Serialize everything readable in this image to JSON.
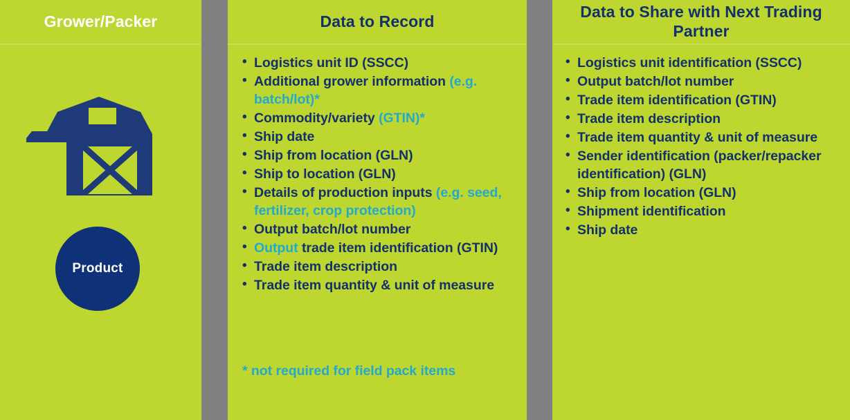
{
  "colors": {
    "panel_green": "#bed730",
    "divider_gray": "#808080",
    "navy": "#14306b",
    "deep_navy": "#0e3177",
    "accent_cyan": "#23a9cc",
    "white": "#ffffff"
  },
  "columns": {
    "left": {
      "header": "Grower/Packer",
      "barn_icon_name": "barn-icon",
      "product_label": "Product"
    },
    "middle": {
      "header": "Data to Record",
      "items": [
        [
          {
            "t": "Logistics unit ID (SSCC)",
            "c": "navy"
          }
        ],
        [
          {
            "t": "Additional grower information ",
            "c": "navy"
          },
          {
            "t": "(e.g. batch/lot)*",
            "c": "accent"
          }
        ],
        [
          {
            "t": "Commodity/variety ",
            "c": "navy"
          },
          {
            "t": "(GTIN)*",
            "c": "accent"
          }
        ],
        [
          {
            "t": "Ship date",
            "c": "navy"
          }
        ],
        [
          {
            "t": "Ship from location (GLN)",
            "c": "navy"
          }
        ],
        [
          {
            "t": "Ship to location (GLN)",
            "c": "navy"
          }
        ],
        [
          {
            "t": "Details of production inputs ",
            "c": "navy"
          },
          {
            "t": "(e.g. seed, fertilizer, crop protection)",
            "c": "accent"
          }
        ],
        [
          {
            "t": "Output batch/lot number",
            "c": "navy"
          }
        ],
        [
          {
            "t": "Output",
            "c": "accent"
          },
          {
            "t": " trade item identification (GTIN)",
            "c": "navy"
          }
        ],
        [
          {
            "t": "Trade item description",
            "c": "navy"
          }
        ],
        [
          {
            "t": "Trade item quantity & unit of measure",
            "c": "navy"
          }
        ]
      ],
      "footnote": "* not required for field pack items"
    },
    "right": {
      "header": "Data to Share with Next Trading Partner",
      "items": [
        [
          {
            "t": "Logistics unit identification (SSCC)",
            "c": "navy"
          }
        ],
        [
          {
            "t": "Output batch/lot number",
            "c": "navy"
          }
        ],
        [
          {
            "t": "Trade item identification (GTIN)",
            "c": "navy"
          }
        ],
        [
          {
            "t": "Trade item description",
            "c": "navy"
          }
        ],
        [
          {
            "t": "Trade item quantity & unit of measure",
            "c": "navy"
          }
        ],
        [
          {
            "t": "Sender identification (packer/repacker identification) (GLN)",
            "c": "navy"
          }
        ],
        [
          {
            "t": "Ship from location (GLN)",
            "c": "navy"
          }
        ],
        [
          {
            "t": "Shipment identification",
            "c": "navy"
          }
        ],
        [
          {
            "t": "Ship date",
            "c": "navy"
          }
        ]
      ]
    }
  }
}
